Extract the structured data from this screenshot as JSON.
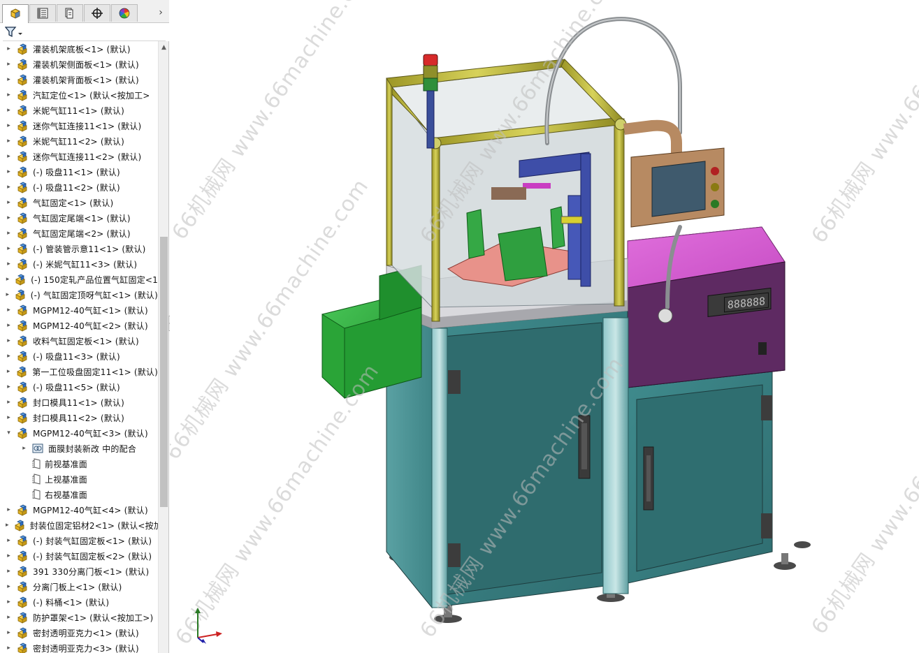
{
  "tabs": [
    {
      "name": "feature-manager-tab",
      "icon": "feature-tree-icon",
      "active": true
    },
    {
      "name": "property-manager-tab",
      "icon": "property-manager-icon",
      "active": false
    },
    {
      "name": "configuration-manager-tab",
      "icon": "configuration-manager-icon",
      "active": false
    },
    {
      "name": "dimxpert-tab",
      "icon": "dimxpert-crosshair-icon",
      "active": false
    },
    {
      "name": "display-manager-tab",
      "icon": "display-manager-color-wheel-icon",
      "active": false
    }
  ],
  "more_tabs_glyph": "›",
  "tree": {
    "items": [
      {
        "label": "灌装机架底板<1> (默认)",
        "type": "part",
        "expand": "collapsed",
        "indent": 0
      },
      {
        "label": "灌装机架侧面板<1> (默认)",
        "type": "part",
        "expand": "collapsed",
        "indent": 0
      },
      {
        "label": "灌装机架背面板<1> (默认)",
        "type": "part",
        "expand": "collapsed",
        "indent": 0
      },
      {
        "label": "汽缸定位<1> (默认<按加工>",
        "type": "part",
        "expand": "collapsed",
        "indent": 0
      },
      {
        "label": "米妮气缸11<1> (默认)",
        "type": "part",
        "expand": "collapsed",
        "indent": 0
      },
      {
        "label": "迷你气缸连接11<1> (默认)",
        "type": "part",
        "expand": "collapsed",
        "indent": 0
      },
      {
        "label": "米妮气缸11<2> (默认)",
        "type": "part",
        "expand": "collapsed",
        "indent": 0
      },
      {
        "label": "迷你气缸连接11<2> (默认)",
        "type": "part",
        "expand": "collapsed",
        "indent": 0
      },
      {
        "label": "(-) 吸盘11<1> (默认)",
        "type": "part",
        "expand": "collapsed",
        "indent": 0
      },
      {
        "label": "(-) 吸盘11<2> (默认)",
        "type": "part",
        "expand": "collapsed",
        "indent": 0
      },
      {
        "label": "气缸固定<1> (默认)",
        "type": "part",
        "expand": "collapsed",
        "indent": 0
      },
      {
        "label": "气缸固定尾端<1> (默认)",
        "type": "part",
        "expand": "collapsed",
        "indent": 0
      },
      {
        "label": "气缸固定尾端<2> (默认)",
        "type": "part",
        "expand": "collapsed",
        "indent": 0
      },
      {
        "label": "(-) 管装管示意11<1> (默认)",
        "type": "part",
        "expand": "collapsed",
        "indent": 0
      },
      {
        "label": "(-) 米妮气缸11<3> (默认)",
        "type": "part",
        "expand": "collapsed",
        "indent": 0
      },
      {
        "label": "(-) 150定轧产品位置气缸固定<1",
        "type": "part",
        "expand": "collapsed",
        "indent": 0
      },
      {
        "label": "(-) 气缸固定顶呀气缸<1> (默认)",
        "type": "part",
        "expand": "collapsed",
        "indent": 0
      },
      {
        "label": "MGPM12-40气缸<1> (默认)",
        "type": "part",
        "expand": "collapsed",
        "indent": 0
      },
      {
        "label": "MGPM12-40气缸<2> (默认)",
        "type": "part",
        "expand": "collapsed",
        "indent": 0
      },
      {
        "label": "收料气缸固定板<1> (默认)",
        "type": "part",
        "expand": "collapsed",
        "indent": 0
      },
      {
        "label": "(-) 吸盘11<3> (默认)",
        "type": "part",
        "expand": "collapsed",
        "indent": 0
      },
      {
        "label": "第一工位吸盘固定11<1> (默认)",
        "type": "part",
        "expand": "collapsed",
        "indent": 0
      },
      {
        "label": "(-) 吸盘11<5> (默认)",
        "type": "part",
        "expand": "collapsed",
        "indent": 0
      },
      {
        "label": "封口模具11<1> (默认)",
        "type": "part",
        "expand": "collapsed",
        "indent": 0
      },
      {
        "label": "封口模具11<2> (默认)",
        "type": "part",
        "expand": "collapsed",
        "indent": 0
      },
      {
        "label": "MGPM12-40气缸<3> (默认)",
        "type": "part",
        "expand": "expanded",
        "indent": 0
      },
      {
        "label": "面膜封装新改 中的配合",
        "type": "mates",
        "expand": "collapsed",
        "indent": 1
      },
      {
        "label": "前视基准面",
        "type": "plane",
        "expand": "none",
        "indent": 1
      },
      {
        "label": "上视基准面",
        "type": "plane",
        "expand": "none",
        "indent": 1
      },
      {
        "label": "右视基准面",
        "type": "plane",
        "expand": "none",
        "indent": 1
      },
      {
        "label": "MGPM12-40气缸<4> (默认)",
        "type": "part",
        "expand": "collapsed",
        "indent": 0
      },
      {
        "label": "封装位固定铝材2<1> (默认<按加",
        "type": "part",
        "expand": "collapsed",
        "indent": 0
      },
      {
        "label": "(-) 封装气缸固定板<1> (默认)",
        "type": "part",
        "expand": "collapsed",
        "indent": 0
      },
      {
        "label": "(-) 封装气缸固定板<2> (默认)",
        "type": "part",
        "expand": "collapsed",
        "indent": 0
      },
      {
        "label": "391 330分离门板<1> (默认)",
        "type": "part",
        "expand": "collapsed",
        "indent": 0
      },
      {
        "label": "分离门板上<1> (默认)",
        "type": "part",
        "expand": "collapsed",
        "indent": 0
      },
      {
        "label": "(-) 料桶<1> (默认)",
        "type": "part",
        "expand": "collapsed",
        "indent": 0
      },
      {
        "label": "防护罩架<1> (默认<按加工>)",
        "type": "part",
        "expand": "collapsed",
        "indent": 0
      },
      {
        "label": "密封透明亚克力<1> (默认)",
        "type": "part",
        "expand": "collapsed",
        "indent": 0
      },
      {
        "label": "密封透明亚克力<3> (默认)",
        "type": "part",
        "expand": "collapsed",
        "indent": 0
      }
    ]
  },
  "scrollbar": {
    "up_glyph": "▲"
  },
  "splitter_glyph": "‹",
  "watermarks": [
    {
      "text": "66机械网 www.66machine.com"
    },
    {
      "text": "66机械网 www.66machine.com"
    },
    {
      "text": "66机械网 www.66machine.com"
    },
    {
      "text": "66机械网 www.66machine.com"
    },
    {
      "text": "66机械网 www.66machine.com"
    },
    {
      "text": "66机械网 www.66machine.com"
    },
    {
      "text": "66机械网 www.66machine.com"
    }
  ],
  "hmi": {
    "display_digits": "888888"
  },
  "colors": {
    "teal_panel": "#3f8a8a",
    "frame_olive": "#b9b43a",
    "magenta_top": "#da60d6",
    "purple_front": "#5e2a62",
    "green_chute": "#29b33a",
    "pink_plate": "#e78f86",
    "hmi_copper": "#b78a62"
  }
}
